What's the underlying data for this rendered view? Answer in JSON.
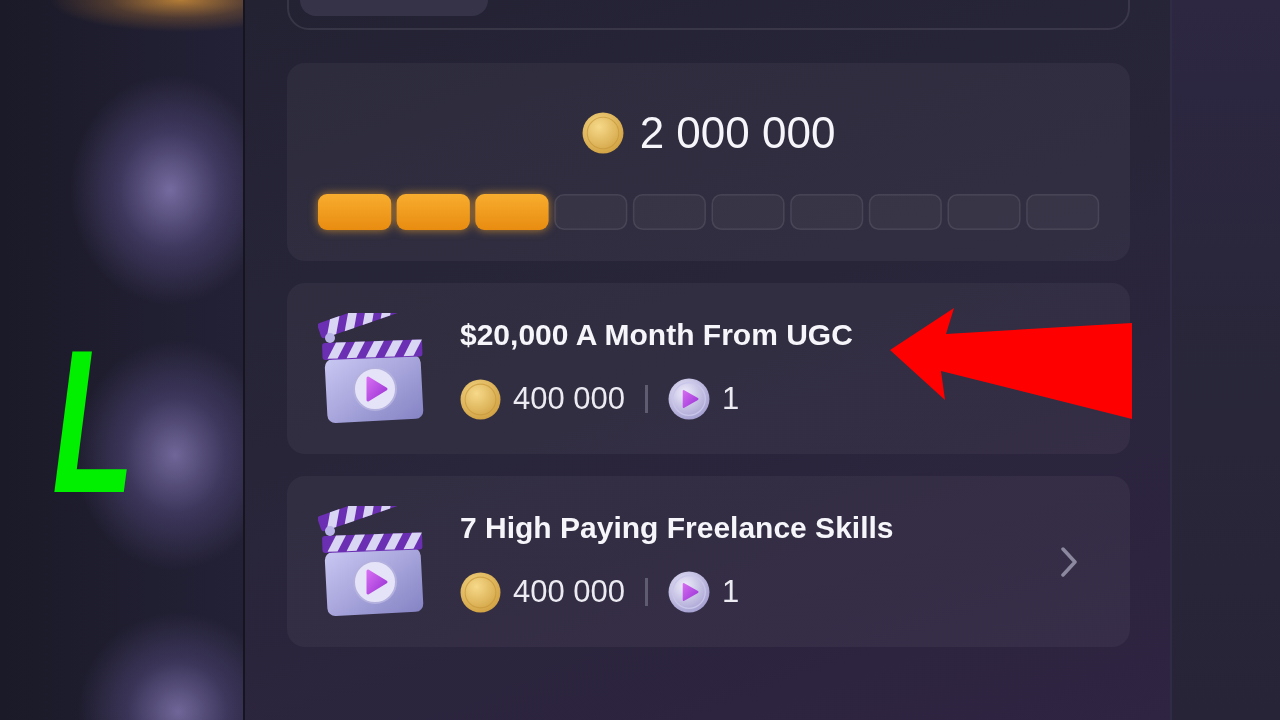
{
  "overlay": {
    "letter": "L"
  },
  "goal": {
    "amount": "2 000 000",
    "progress": {
      "level": 0.3
    }
  },
  "lessons": [
    {
      "title": "$20,000 A Month From UGC",
      "reward": "400 000",
      "videos": "1",
      "chevron": false
    },
    {
      "title": "7 High Paying Freelance Skills",
      "reward": "400 000",
      "videos": "1",
      "chevron": true
    }
  ]
}
